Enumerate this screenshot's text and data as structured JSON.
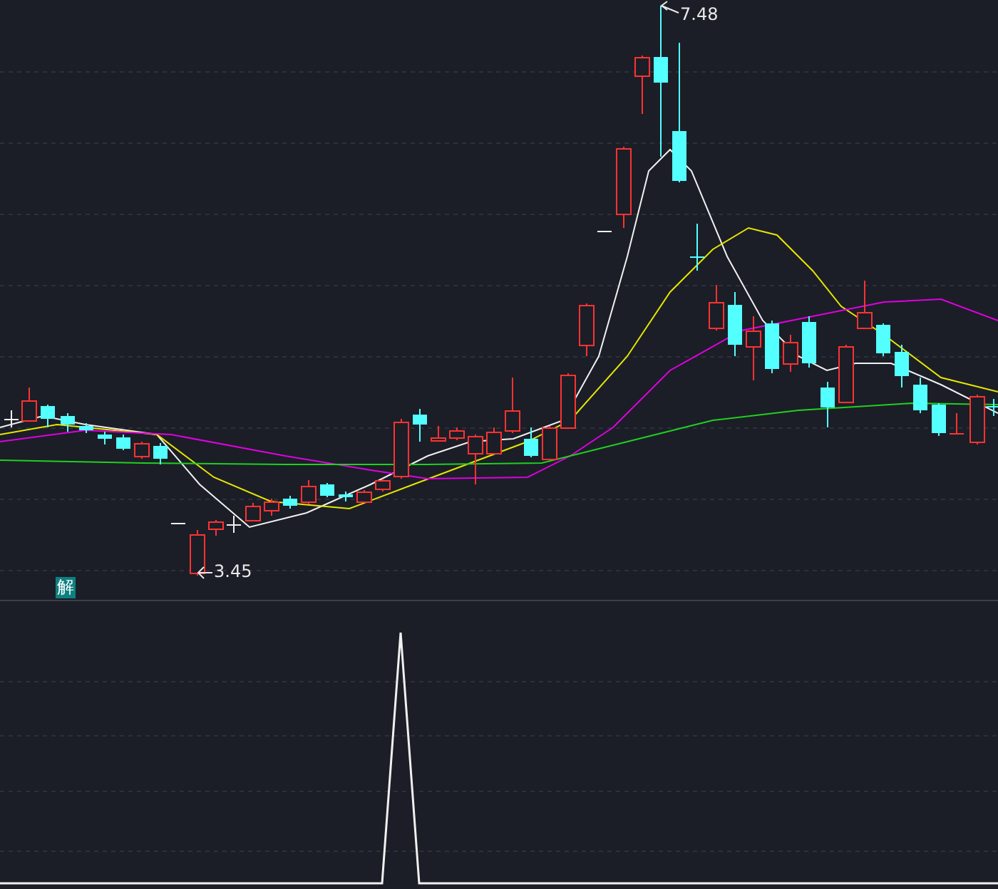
{
  "price_panel": {
    "high_label": "7.48",
    "low_label": "3.45",
    "signal_badge": "解"
  }
}
